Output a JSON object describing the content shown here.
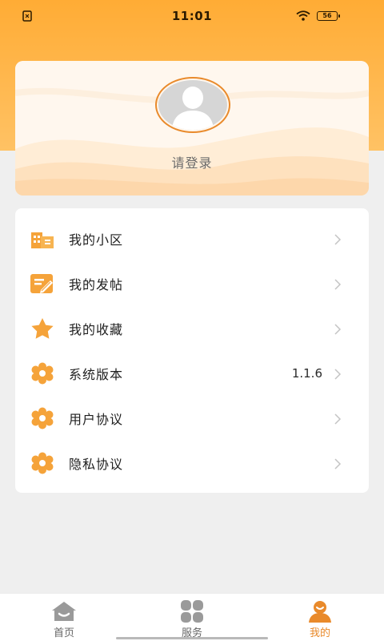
{
  "status_bar": {
    "time": "11:01",
    "battery": "56",
    "icons": [
      "sim-icon",
      "wifi-icon",
      "battery-icon"
    ]
  },
  "profile": {
    "login_prompt": "请登录",
    "avatar": "default-avatar-icon"
  },
  "menu": {
    "items": [
      {
        "label": "我的小区",
        "value": "",
        "icon": "building-icon"
      },
      {
        "label": "我的发帖",
        "value": "",
        "icon": "edit-post-icon"
      },
      {
        "label": "我的收藏",
        "value": "",
        "icon": "star-icon"
      },
      {
        "label": "系统版本",
        "value": "1.1.6",
        "icon": "flower-gear-icon"
      },
      {
        "label": "用户协议",
        "value": "",
        "icon": "flower-gear-icon"
      },
      {
        "label": "隐私协议",
        "value": "",
        "icon": "flower-gear-icon"
      }
    ]
  },
  "tabbar": {
    "tabs": [
      {
        "label": "首页",
        "icon": "home-icon",
        "active": false
      },
      {
        "label": "服务",
        "icon": "grid-icon",
        "active": false
      },
      {
        "label": "我的",
        "icon": "user-icon",
        "active": true
      }
    ]
  },
  "colors": {
    "accent": "#e98a2b",
    "icon_orange": "#f5a33a",
    "header": "#ffac35",
    "background": "#efefef"
  }
}
